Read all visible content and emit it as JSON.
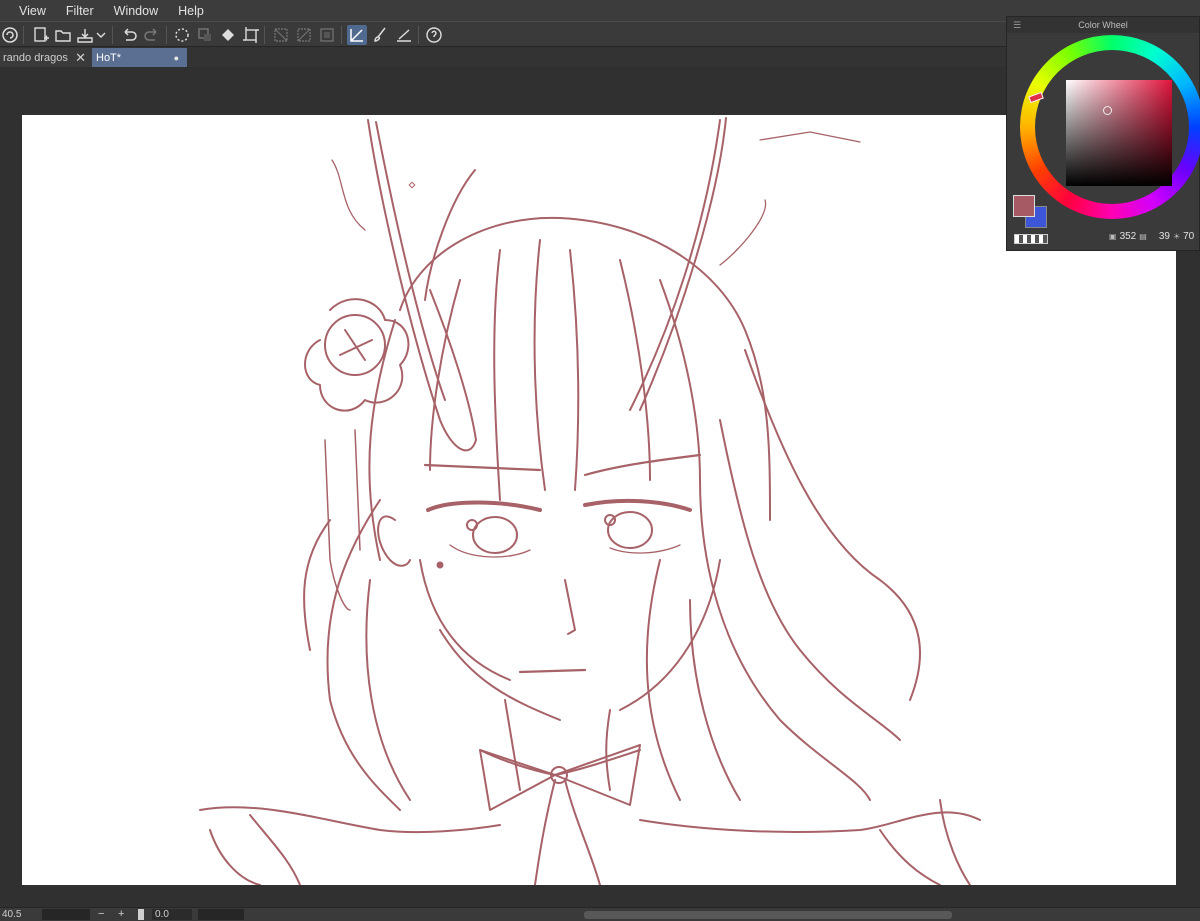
{
  "menubar": {
    "items": [
      "View",
      "Filter",
      "Window",
      "Help"
    ]
  },
  "toolbar": {
    "icons": [
      "clip-studio-icon",
      "new-file-icon",
      "open-file-icon",
      "save-icon",
      "dropdown-icon",
      "undo-icon",
      "redo-icon",
      "transform-icon",
      "selection-icon",
      "fill-icon",
      "crop-icon",
      "hide-selection-icon",
      "invert-selection-icon",
      "border-icon",
      "ruler-snap-icon",
      "brush-snap-icon",
      "special-ruler-icon",
      "help-icon"
    ]
  },
  "tabs": [
    {
      "label": "rando dragos",
      "close": "✕"
    },
    {
      "label": "HoT*",
      "modified": "●"
    }
  ],
  "statusbar": {
    "zoom": "40.5",
    "minus": "−",
    "plus": "+",
    "angle": "0.0"
  },
  "color_wheel": {
    "title": "Color Wheel",
    "hue": "352",
    "saturation": "39",
    "value": "70",
    "main_color": "#a65a63",
    "sub_color": "#3d56d8"
  },
  "canvas": {
    "stroke_color": "#a76268",
    "background": "#ffffff"
  }
}
